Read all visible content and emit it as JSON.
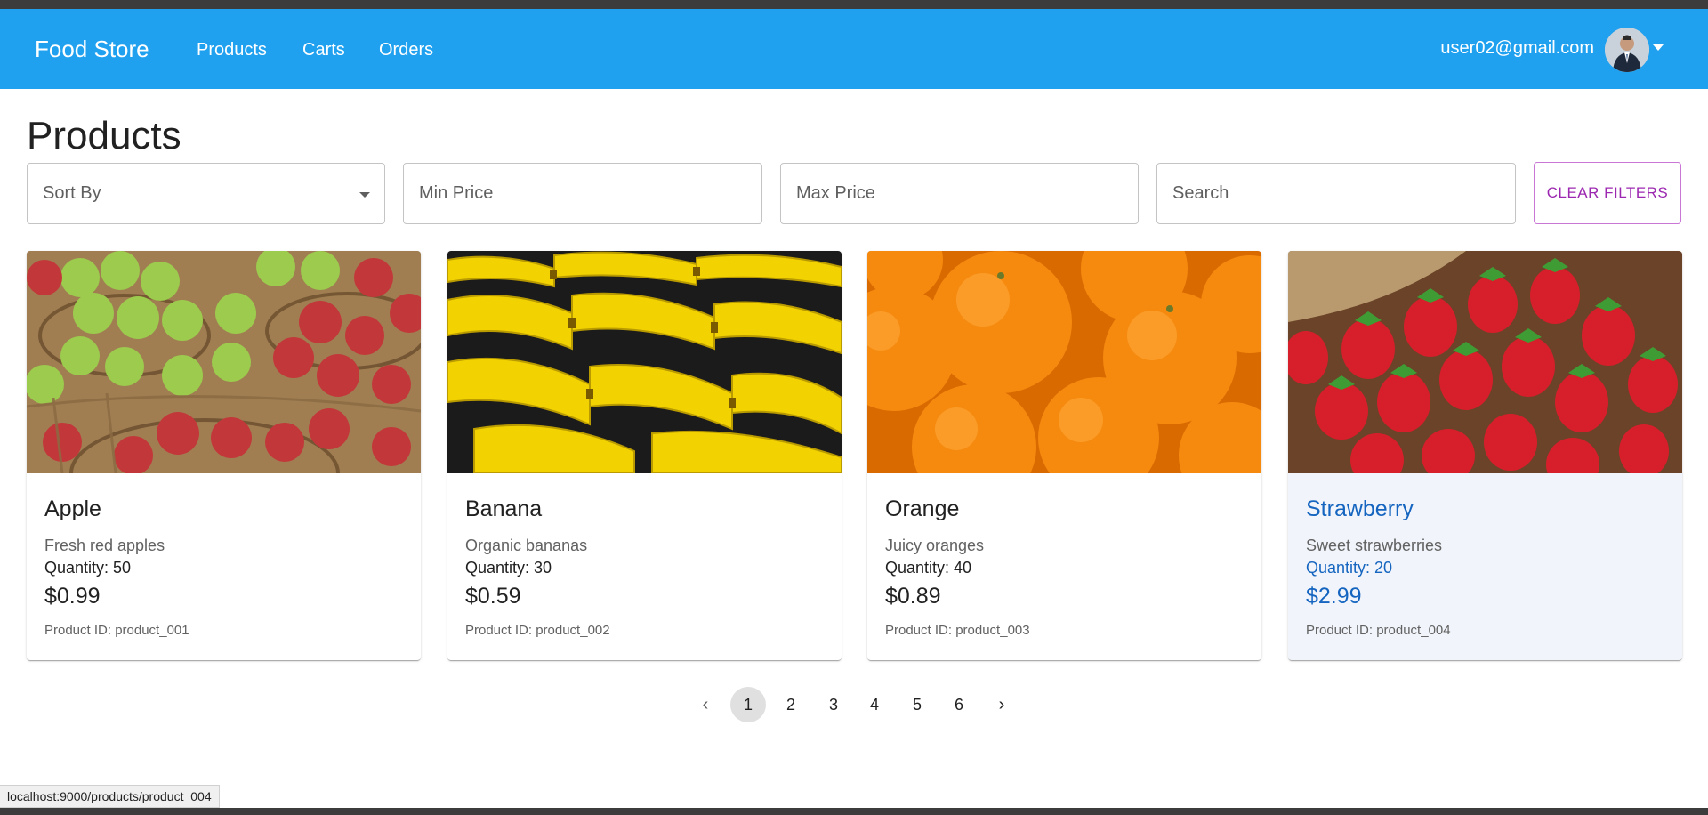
{
  "app": {
    "brand": "Food Store",
    "nav": [
      "Products",
      "Carts",
      "Orders"
    ],
    "user_email": "user02@gmail.com"
  },
  "page": {
    "title": "Products"
  },
  "filters": {
    "sort_placeholder": "Sort By",
    "min_price_placeholder": "Min Price",
    "max_price_placeholder": "Max Price",
    "search_placeholder": "Search",
    "clear_label": "CLEAR FILTERS"
  },
  "products": [
    {
      "name": "Apple",
      "description": "Fresh red apples",
      "quantity": "Quantity: 50",
      "price": "$0.99",
      "id": "Product ID: product_001"
    },
    {
      "name": "Banana",
      "description": "Organic bananas",
      "quantity": "Quantity: 30",
      "price": "$0.59",
      "id": "Product ID: product_002"
    },
    {
      "name": "Orange",
      "description": "Juicy oranges",
      "quantity": "Quantity: 40",
      "price": "$0.89",
      "id": "Product ID: product_003"
    },
    {
      "name": "Strawberry",
      "description": "Sweet strawberries",
      "quantity": "Quantity: 20",
      "price": "$2.99",
      "id": "Product ID: product_004"
    }
  ],
  "pagination": {
    "pages": [
      "1",
      "2",
      "3",
      "4",
      "5",
      "6"
    ],
    "current": "1",
    "prev": "‹",
    "next": "›"
  },
  "status_bar": {
    "url": "localhost:9000/products/product_004"
  },
  "colors": {
    "appbar": "#1fa1f0",
    "accent": "#9c27b0",
    "link_hover": "#1565c0"
  },
  "icons": {
    "sort": "chevron-down-icon",
    "prev": "chevron-left-icon",
    "next": "chevron-right-icon",
    "avatar_menu": "caret-down-icon"
  }
}
